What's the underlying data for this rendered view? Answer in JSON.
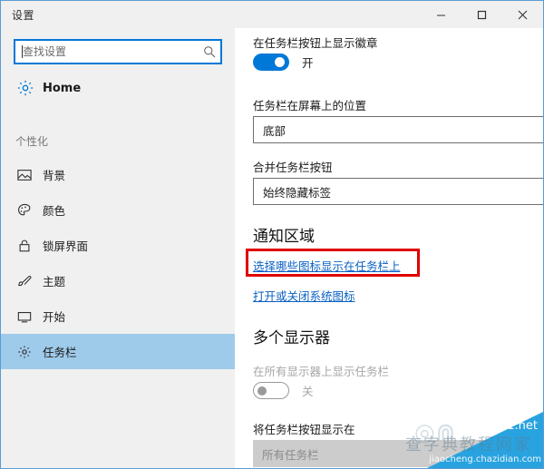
{
  "window": {
    "title": "设置",
    "controls": {
      "minimize": "minimize-button",
      "maximize": "maximize-button",
      "close": "close-button"
    }
  },
  "sidebar": {
    "search": {
      "placeholder": "查找设置",
      "value": ""
    },
    "home": {
      "label": "Home",
      "icon": "gear-icon"
    },
    "group_header": "个性化",
    "items": [
      {
        "label": "背景",
        "icon": "picture-icon",
        "selected": false
      },
      {
        "label": "颜色",
        "icon": "palette-icon",
        "selected": false
      },
      {
        "label": "锁屏界面",
        "icon": "lock-icon",
        "selected": false
      },
      {
        "label": "主题",
        "icon": "paintbrush-icon",
        "selected": false
      },
      {
        "label": "开始",
        "icon": "monitor-icon",
        "selected": false
      },
      {
        "label": "任务栏",
        "icon": "gear-icon",
        "selected": true
      }
    ]
  },
  "content": {
    "badges_label": "在任务栏按钮上显示徽章",
    "badges_toggle_state": "开",
    "position_label": "任务栏在屏幕上的位置",
    "position_value": "底部",
    "combine_label": "合并任务栏按钮",
    "combine_value": "始终隐藏标签",
    "notification_section_title": "通知区域",
    "select_icons_link": "选择哪些图标显示在任务栏上",
    "system_icons_link": "打开或关闭系统图标",
    "multi_display_section_title": "多个显示器",
    "show_all_displays_label": "在所有显示器上显示任务栏",
    "show_all_displays_toggle_state": "关",
    "buttons_on_label": "将任务栏按钮显示在",
    "buttons_on_value": "所有任务栏"
  },
  "highlight": {
    "color": "#e00000",
    "target": "select_icons_link"
  },
  "watermark": {
    "brand": "jb51.net",
    "chinese": "查字典教程网家",
    "url": "jiaocheng.chazidian.com"
  },
  "colors": {
    "accent": "#0078d7",
    "selection": "#9fcbea",
    "chrome": "#f0f0f0",
    "link": "#0a60c2",
    "highlight": "#e00000",
    "watermark": "#29a3e0"
  }
}
